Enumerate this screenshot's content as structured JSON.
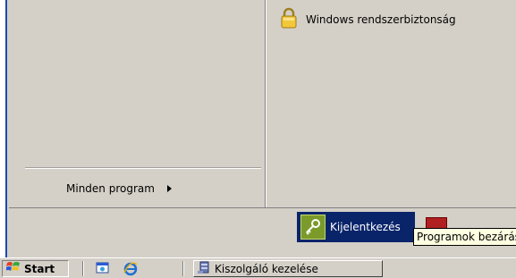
{
  "start_menu": {
    "right_items": [
      {
        "label": "Windows rendszerbiztonság",
        "icon": "padlock-icon"
      }
    ],
    "all_programs_label": "Minden program",
    "logoff_label": "Kijelentkezés",
    "shutdown_tooltip": "Programok bezárása"
  },
  "taskbar": {
    "start_label": "Start",
    "task_button_label": "Kiszolgáló kezelése"
  },
  "colors": {
    "menu_bg": "#d4d0c8",
    "highlight": "#0a246a",
    "accent_blue": "#184ab4",
    "tooltip_bg": "#ffffe1"
  }
}
